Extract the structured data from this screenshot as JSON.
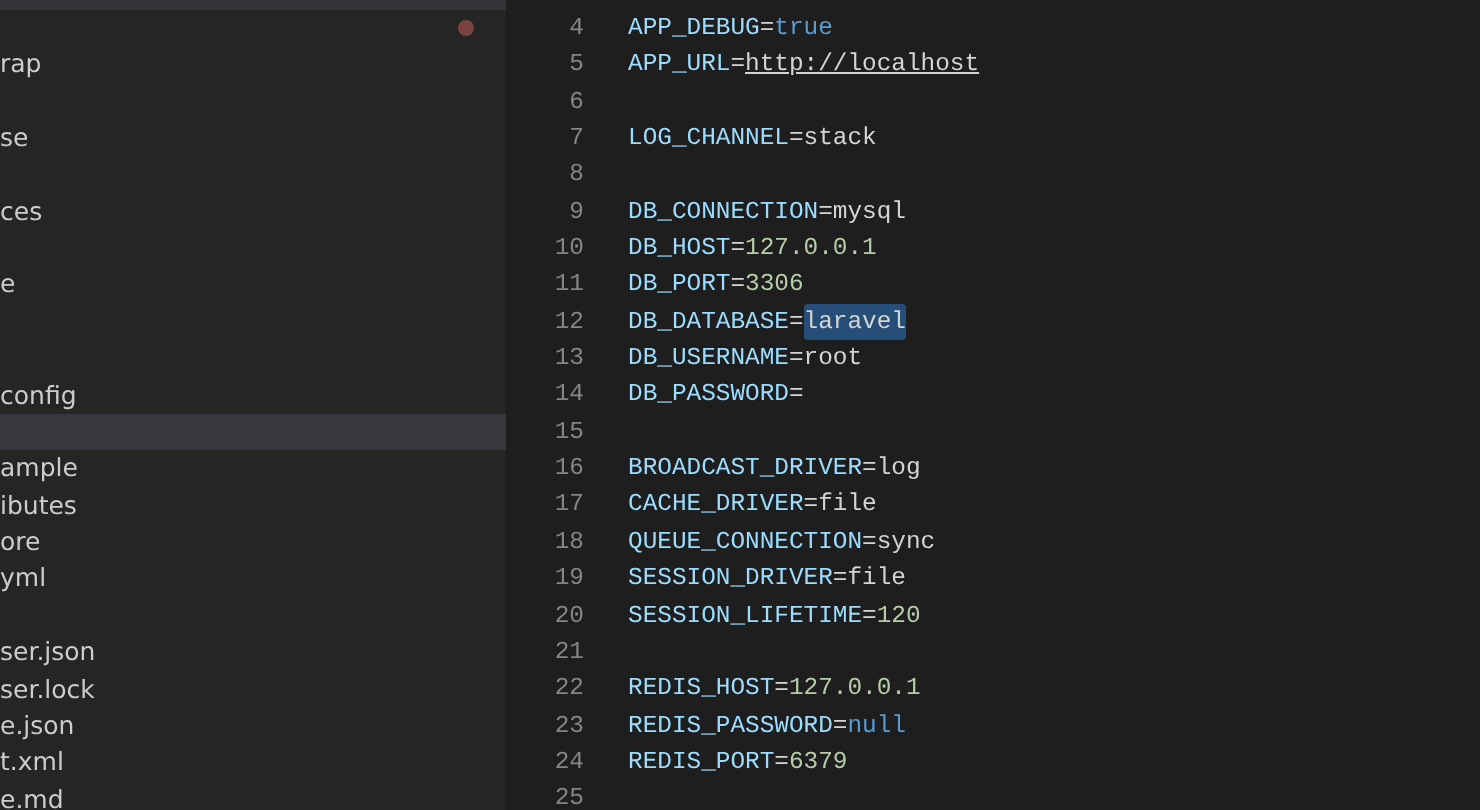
{
  "sidebar": {
    "modified": true,
    "items": [
      {
        "kind": "file",
        "label": "rap",
        "selected": false
      },
      {
        "kind": "blank"
      },
      {
        "kind": "file",
        "label": "se",
        "selected": false
      },
      {
        "kind": "blank"
      },
      {
        "kind": "file",
        "label": "ces",
        "selected": false
      },
      {
        "kind": "blank"
      },
      {
        "kind": "file",
        "label": "e",
        "selected": false
      },
      {
        "kind": "blank"
      },
      {
        "kind": "blank"
      },
      {
        "kind": "file",
        "label": "config",
        "selected": false
      },
      {
        "kind": "file",
        "selected": true
      },
      {
        "kind": "file",
        "label": "ample",
        "selected": false
      },
      {
        "kind": "file",
        "label": "ibutes",
        "selected": false
      },
      {
        "kind": "file",
        "label": "ore",
        "selected": false
      },
      {
        "kind": "file",
        "label": "yml",
        "selected": false
      },
      {
        "kind": "blank"
      },
      {
        "kind": "file",
        "label": "ser.json",
        "selected": false
      },
      {
        "kind": "file",
        "label": "ser.lock",
        "selected": false
      },
      {
        "kind": "file",
        "label": "e.json",
        "selected": false
      },
      {
        "kind": "file",
        "label": "t.xml",
        "selected": false
      },
      {
        "kind": "file",
        "label": "e.md",
        "selected": false
      }
    ]
  },
  "editor": {
    "lines": [
      {
        "number": "4",
        "key": "APP_DEBUG",
        "op": "=",
        "value": {
          "text": "true",
          "kind": "keyword",
          "highlighted": false
        }
      },
      {
        "number": "5",
        "key": "APP_URL",
        "op": "=",
        "value": {
          "text": "http://localhost",
          "kind": "link",
          "highlighted": false
        }
      },
      {
        "number": "6"
      },
      {
        "number": "7",
        "key": "LOG_CHANNEL",
        "op": "=",
        "value": {
          "text": "stack",
          "kind": "text",
          "highlighted": false
        }
      },
      {
        "number": "8"
      },
      {
        "number": "9",
        "key": "DB_CONNECTION",
        "op": "=",
        "value": {
          "text": "mysql",
          "kind": "text",
          "highlighted": false
        }
      },
      {
        "number": "10",
        "key": "DB_HOST",
        "op": "=",
        "value": {
          "text": "127.0.0.1",
          "kind": "number",
          "highlighted": false
        }
      },
      {
        "number": "11",
        "key": "DB_PORT",
        "op": "=",
        "value": {
          "text": "3306",
          "kind": "number",
          "highlighted": false
        }
      },
      {
        "number": "12",
        "key": "DB_DATABASE",
        "op": "=",
        "value": {
          "text": "laravel",
          "kind": "text",
          "highlighted": true
        }
      },
      {
        "number": "13",
        "key": "DB_USERNAME",
        "op": "=",
        "value": {
          "text": "root",
          "kind": "text",
          "highlighted": false
        }
      },
      {
        "number": "14",
        "key": "DB_PASSWORD",
        "op": "="
      },
      {
        "number": "15"
      },
      {
        "number": "16",
        "key": "BROADCAST_DRIVER",
        "op": "=",
        "value": {
          "text": "log",
          "kind": "text",
          "highlighted": false
        }
      },
      {
        "number": "17",
        "key": "CACHE_DRIVER",
        "op": "=",
        "value": {
          "text": "file",
          "kind": "text",
          "highlighted": false
        }
      },
      {
        "number": "18",
        "key": "QUEUE_CONNECTION",
        "op": "=",
        "value": {
          "text": "sync",
          "kind": "text",
          "highlighted": false
        }
      },
      {
        "number": "19",
        "key": "SESSION_DRIVER",
        "op": "=",
        "value": {
          "text": "file",
          "kind": "text",
          "highlighted": false
        }
      },
      {
        "number": "20",
        "key": "SESSION_LIFETIME",
        "op": "=",
        "value": {
          "text": "120",
          "kind": "number",
          "highlighted": false
        }
      },
      {
        "number": "21"
      },
      {
        "number": "22",
        "key": "REDIS_HOST",
        "op": "=",
        "value": {
          "text": "127.0.0.1",
          "kind": "number",
          "highlighted": false
        }
      },
      {
        "number": "23",
        "key": "REDIS_PASSWORD",
        "op": "=",
        "value": {
          "text": "null",
          "kind": "keyword",
          "highlighted": false
        }
      },
      {
        "number": "24",
        "key": "REDIS_PORT",
        "op": "=",
        "value": {
          "text": "6379",
          "kind": "number",
          "highlighted": false
        }
      },
      {
        "number": "25"
      }
    ]
  }
}
